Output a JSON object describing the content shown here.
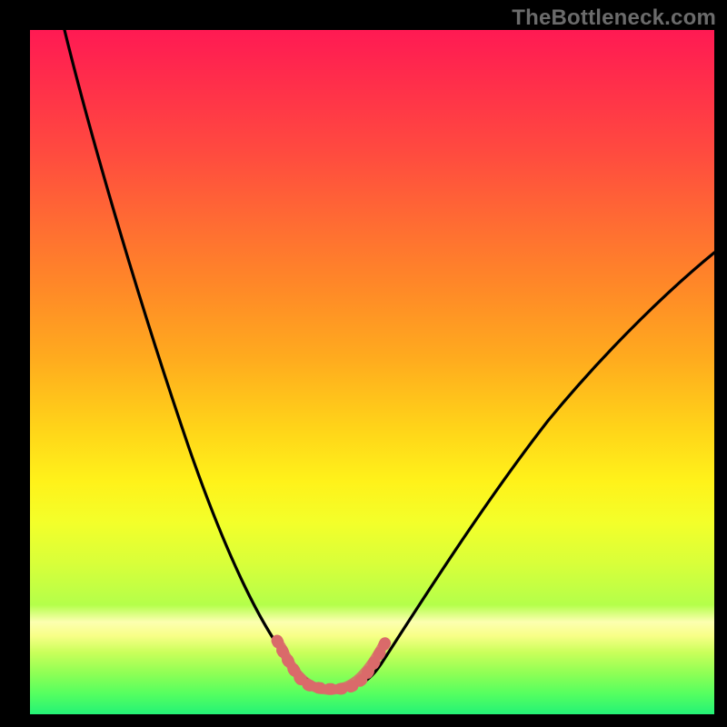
{
  "watermark": "TheBottleneck.com",
  "colors": {
    "frame": "#000000",
    "curve_main": "#000000",
    "curve_accent": "#d96a6a"
  },
  "chart_data": {
    "type": "line",
    "title": "",
    "xlabel": "",
    "ylabel": "",
    "xlim": [
      0,
      100
    ],
    "ylim": [
      0,
      100
    ],
    "grid": false,
    "series": [
      {
        "name": "main-curve",
        "x": [
          5,
          10,
          15,
          20,
          25,
          30,
          33,
          36,
          38,
          40,
          42,
          44,
          46,
          48,
          50,
          55,
          60,
          65,
          70,
          75,
          80,
          85,
          90,
          95,
          100
        ],
        "y": [
          100,
          85,
          70,
          56,
          43,
          30,
          22,
          15,
          10,
          6,
          3,
          2,
          2,
          3,
          5,
          12,
          20,
          29,
          38,
          46,
          54,
          61,
          67,
          71,
          74
        ]
      }
    ],
    "accent_segment": {
      "description": "highlighted pink U-shaped segment near trough",
      "x": [
        36,
        38,
        40,
        42,
        44,
        46,
        48,
        50
      ],
      "y": [
        15,
        10,
        6,
        3,
        2,
        2,
        3,
        5
      ]
    }
  }
}
